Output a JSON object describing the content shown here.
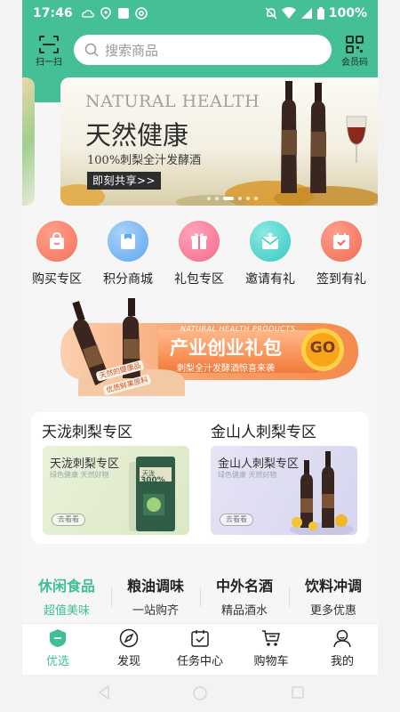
{
  "status_bar": {
    "time": "17:46",
    "battery": "100%"
  },
  "header": {
    "scan_label": "扫一扫",
    "search_placeholder": "搜索商品",
    "vip_label": "会员码"
  },
  "banner": {
    "title_en": "NATURAL HEALTH",
    "title_cn": "天然健康",
    "subtitle": "100%刺梨全汁发酵酒",
    "cta": "即刻共享>>",
    "slides": 6,
    "active_slide": 3
  },
  "nav": {
    "items": [
      {
        "label": "购买专区",
        "icon": "shopping-bag-icon",
        "color": "#f4735f"
      },
      {
        "label": "积分商城",
        "icon": "points-store-icon",
        "color": "#5fa7f0"
      },
      {
        "label": "礼包专区",
        "icon": "gift-icon",
        "color": "#f46a8a"
      },
      {
        "label": "邀请有礼",
        "icon": "invite-envelope-icon",
        "color": "#35c9c1"
      },
      {
        "label": "签到有礼",
        "icon": "calendar-check-icon",
        "color": "#f26a55"
      }
    ]
  },
  "promo": {
    "en": "NATURAL HEALTH PRODUCTS",
    "title": "产业创业礼包",
    "sub": "刺梨全汁发酵酒惊喜来袭",
    "go": "GO",
    "tag1": "天然的健康品",
    "tag2": "优质鲜果原料"
  },
  "zones": [
    {
      "title": "天泷刺梨专区",
      "card_title": "天泷刺梨专区",
      "card_sub": "绿色健康 天然好物",
      "btn": "去看看",
      "can_text": "天泷",
      "can_num": "300%"
    },
    {
      "title": "金山人刺梨专区",
      "card_title": "金山人刺梨专区",
      "card_sub": "绿色健康 天然好物",
      "btn": "去看看"
    }
  ],
  "categories": [
    {
      "title": "休闲食品",
      "sub": "超值美味",
      "active": true
    },
    {
      "title": "粮油调味",
      "sub": "一站购齐",
      "active": false
    },
    {
      "title": "中外名酒",
      "sub": "精品酒水",
      "active": false
    },
    {
      "title": "饮料冲调",
      "sub": "更多优惠",
      "active": false
    }
  ],
  "tabbar": [
    {
      "label": "优选",
      "icon": "home-shield-icon",
      "active": true
    },
    {
      "label": "发现",
      "icon": "compass-icon",
      "active": false
    },
    {
      "label": "任务中心",
      "icon": "task-calendar-icon",
      "active": false
    },
    {
      "label": "购物车",
      "icon": "cart-icon",
      "active": false
    },
    {
      "label": "我的",
      "icon": "user-icon",
      "active": false
    }
  ],
  "colors": {
    "brand": "#45bf97",
    "active_text": "#3fbf96"
  }
}
